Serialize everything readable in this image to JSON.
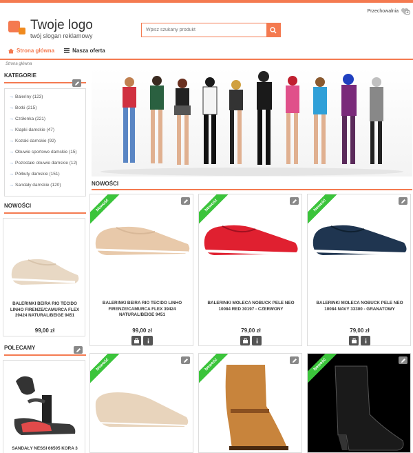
{
  "header": {
    "wishlist_label": "Przechowalnia",
    "wishlist_count": "2",
    "logo_title": "Twoje logo",
    "logo_slogan": "twój slogan reklamowy",
    "search_placeholder": "Wpisz szukany produkt"
  },
  "nav": {
    "home": "Strona główna",
    "offer": "Nasza oferta"
  },
  "breadcrumb": "Strona główna",
  "sidebar": {
    "categories_title": "KATEGORIE",
    "categories": [
      "Baleriny (123)",
      "Botki (215)",
      "Czółenka (221)",
      "Klapki damskie (47)",
      "Kozaki damskie (92)",
      "Obuwie sportowe damskie (15)",
      "Pozostałe obuwie damskie (12)",
      "Półbuty damskie (151)",
      "Sandały damskie (120)"
    ],
    "new_title": "NOWOŚCI",
    "new_product_name": "BALERINKI BEIRA RIO TECIDO LINHO FIRENZE/CAMURCA FLEX 39424 NATURAL/BEIGE 9451",
    "new_product_price": "99,00 zł",
    "recommended_title": "POLECAMY",
    "recommended_product_name": "SANDAŁY NESSI 66505 KORA 3"
  },
  "main": {
    "section_title": "NOWOŚCI",
    "ribbon_label": "Nowość",
    "products": [
      {
        "name": "BALERINKI BEIRA RIO TECIDO LINHO FIRENZE/CAMURCA FLEX 39424 NATURAL/BEIGE 9451",
        "price": "99,00 zł",
        "color": "#e8c9aa",
        "sole": "#fff"
      },
      {
        "name": "BALERINKI MOLECA NOBUCK PELE NEO 10084 RED 30197 - CZERWONY",
        "price": "79,00 zł",
        "color": "#e02030",
        "sole": "#fff"
      },
      {
        "name": "BALERINKI MOLECA NOBUCK PELE NEO 10084 NAVY 33300 - GRANATOWY",
        "price": "79,00 zł",
        "color": "#1f3550",
        "sole": "#fff"
      }
    ]
  },
  "colors": {
    "accent": "#f47a50",
    "ribbon": "#3bc43b",
    "link": "#3a6fb5"
  }
}
